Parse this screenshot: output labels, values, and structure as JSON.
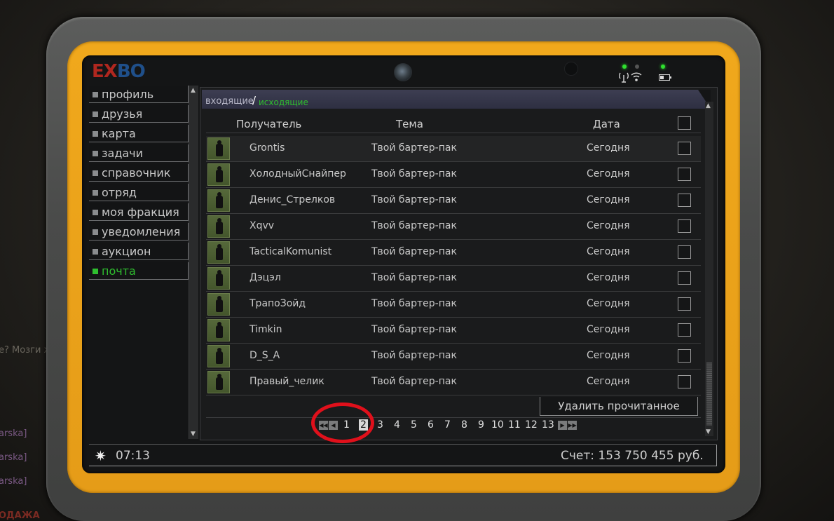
{
  "background": {
    "side_text": "e? Мозги ж",
    "chat_lines": [
      "arska]",
      "arska]",
      "arska]"
    ],
    "bottom_text": "ОДАЖА"
  },
  "device": {
    "logo_left": "EX",
    "logo_right": "BO",
    "status_icons": [
      "wifi-icon",
      "battery-icon"
    ]
  },
  "sidebar": {
    "items": [
      {
        "label": "профиль"
      },
      {
        "label": "друзья"
      },
      {
        "label": "карта"
      },
      {
        "label": "задачи"
      },
      {
        "label": "справочник"
      },
      {
        "label": "отряд"
      },
      {
        "label": "моя фракция"
      },
      {
        "label": "уведомления"
      },
      {
        "label": "аукцион"
      },
      {
        "label": "почта",
        "active": true
      }
    ]
  },
  "mail": {
    "tab_inbox": "входящие",
    "tab_separator": "/",
    "tab_outbox": "исходящие",
    "columns": {
      "recipient": "Получатель",
      "subject": "Тема",
      "date": "Дата"
    },
    "rows": [
      {
        "recipient": "Grontis",
        "subject": "Твой бартер-пак",
        "date": "Сегодня"
      },
      {
        "recipient": "ХолодныйСнайпер",
        "subject": "Твой бартер-пак",
        "date": "Сегодня"
      },
      {
        "recipient": "Денис_Стрелков",
        "subject": "Твой бартер-пак",
        "date": "Сегодня"
      },
      {
        "recipient": "Xqvv",
        "subject": "Твой бартер-пак",
        "date": "Сегодня"
      },
      {
        "recipient": "TacticalKomunist",
        "subject": "Твой бартер-пак",
        "date": "Сегодня"
      },
      {
        "recipient": "Дэцэл",
        "subject": "Твой бартер-пак",
        "date": "Сегодня"
      },
      {
        "recipient": "ТрапоЗойд",
        "subject": "Твой бартер-пак",
        "date": "Сегодня"
      },
      {
        "recipient": "Timkin",
        "subject": "Твой бартер-пак",
        "date": "Сегодня"
      },
      {
        "recipient": "D_S_A",
        "subject": "Твой бартер-пак",
        "date": "Сегодня"
      },
      {
        "recipient": "Правый_челик",
        "subject": "Твой бартер-пак",
        "date": "Сегодня"
      }
    ],
    "delete_read_label": "Удалить прочитанное",
    "pager": {
      "pages": [
        "1",
        "2",
        "3",
        "4",
        "5",
        "6",
        "7",
        "8",
        "9",
        "10",
        "11",
        "12",
        "13"
      ],
      "current": "2"
    }
  },
  "footer": {
    "time": "07:13",
    "account": "Счет: 153 750 455 руб."
  },
  "colors": {
    "accent_green": "#2fbf2f",
    "frame_yellow": "#f0a81c",
    "highlight_red": "#e0101b"
  }
}
